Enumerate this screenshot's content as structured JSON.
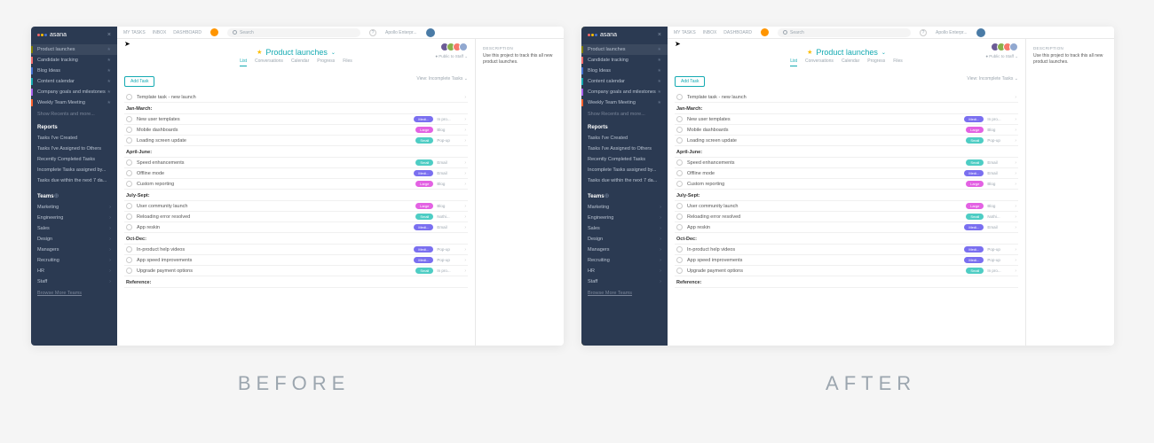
{
  "labels": {
    "before": "BEFORE",
    "after": "AFTER"
  },
  "brand": "asana",
  "topnav": [
    "MY TASKS",
    "INBOX",
    "DASHBOARD"
  ],
  "search_placeholder": "Search",
  "workspace": "Apollo Enterpr...",
  "sidebar": {
    "favorites": [
      {
        "label": "Product launches",
        "color": "#808000",
        "active": true
      },
      {
        "label": "Candidate tracking",
        "color": "#f06a6a"
      },
      {
        "label": "Blog Ideas",
        "color": "#4573d2"
      },
      {
        "label": "Content calendar",
        "color": "#14aab2"
      },
      {
        "label": "Company goals and milestones",
        "color": "#a960ed"
      },
      {
        "label": "Weekly Team Meeting",
        "color": "#fd612c"
      }
    ],
    "show_more": "Show Recents and more...",
    "reports_label": "Reports",
    "reports": [
      "Tasks I've Created",
      "Tasks I've Assigned to Others",
      "Recently Completed Tasks",
      "Incomplete Tasks assigned by...",
      "Tasks due within the next 7 da..."
    ],
    "teams_label": "Teams",
    "teams": [
      "Marketing",
      "Engineering",
      "Sales",
      "Design",
      "Managers",
      "Recruiting",
      "HR",
      "Staff"
    ],
    "browse": "Browse More Teams"
  },
  "project": {
    "title": "Product launches",
    "public": "Public to Staff",
    "tabs": [
      "List",
      "Conversations",
      "Calendar",
      "Progress",
      "Files"
    ],
    "add_task": "Add Task",
    "view": "View: Incomplete Tasks",
    "desc_label": "DESCRIPTION",
    "desc": "Use this project to track this all new product launches.",
    "sections": [
      {
        "name": "",
        "tasks": [
          {
            "n": "Template task - new launch"
          }
        ]
      },
      {
        "name": "Jan-March:",
        "tasks": [
          {
            "n": "New user templates",
            "tag": "Medi...",
            "tc": "purple",
            "a": "In pro..."
          },
          {
            "n": "Mobile dashboards",
            "tag": "Large",
            "tc": "pink",
            "a": "Blog"
          },
          {
            "n": "Loading screen update",
            "tag": "Small",
            "tc": "teal",
            "a": "Pop-up"
          }
        ]
      },
      {
        "name": "April-June:",
        "tasks": [
          {
            "n": "Speed enhancements",
            "tag": "Small",
            "tc": "teal",
            "a": "Email"
          },
          {
            "n": "Offline mode",
            "tag": "Medi...",
            "tc": "purple",
            "a": "Email"
          },
          {
            "n": "Custom reporting",
            "tag": "Large",
            "tc": "pink",
            "a": "Blog"
          }
        ]
      },
      {
        "name": "July-Sept:",
        "tasks": [
          {
            "n": "User community launch",
            "tag": "Large",
            "tc": "pink",
            "a": "Blog"
          },
          {
            "n": "Reloading error resolved",
            "tag": "Small",
            "tc": "teal",
            "a": "Nothi..."
          },
          {
            "n": "App reskin",
            "tag": "Medi...",
            "tc": "purple",
            "a": "Email"
          }
        ]
      },
      {
        "name": "Oct-Dec:",
        "tasks": [
          {
            "n": "In-product help videos",
            "tag": "Medi...",
            "tc": "purple",
            "a": "Pop-up"
          },
          {
            "n": "App speed improvements",
            "tag": "Medi...",
            "tc": "purple",
            "a": "Pop-up"
          },
          {
            "n": "Upgrade payment options",
            "tag": "Small",
            "tc": "teal",
            "a": "In pro..."
          }
        ]
      },
      {
        "name": "Reference:",
        "tasks": []
      }
    ]
  }
}
